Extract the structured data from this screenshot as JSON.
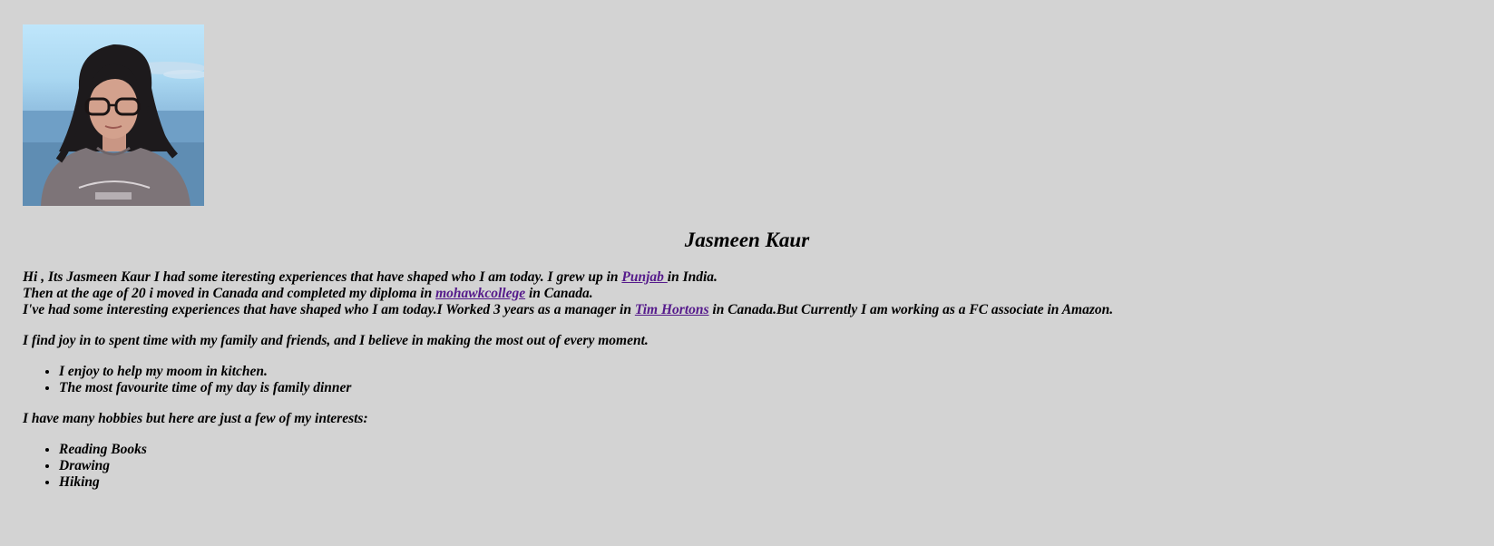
{
  "profile": {
    "name": "Jasmeen Kaur"
  },
  "intro": {
    "line1_a": "Hi , Its Jasmeen Kaur I had some iteresting experiences that have shaped who I am today. I grew up in ",
    "link_punjab": "Punjab ",
    "line1_b": "in India.",
    "line2_a": "Then at the age of 20 i moved in Canada and completed my diploma in ",
    "link_mohawk": "mohawkcollege",
    "line2_b": " in Canada.",
    "line3_a": "I've had some interesting experiences that have shaped who I am today.I Worked 3 years as a manager in ",
    "link_tim": "Tim Hortons",
    "line3_b": " in Canada.But Currently I am working as a FC associate in Amazon."
  },
  "joy": {
    "text": "I find joy in to spent time with my family and friends, and I believe in making the most out of every moment.",
    "items": [
      "I enjoy to help my moom in kitchen.",
      "The most favourite time of my day is family dinner"
    ]
  },
  "hobbies": {
    "text": "I have many hobbies but here are just a few of my interests:",
    "items": [
      "Reading Books",
      "Drawing",
      "Hiking"
    ]
  }
}
